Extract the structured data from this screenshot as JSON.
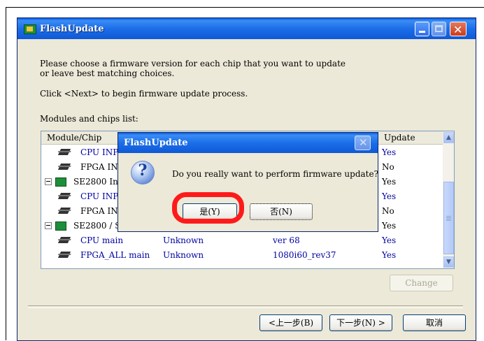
{
  "window": {
    "title": "FlashUpdate",
    "icon": "flash-update-app-icon"
  },
  "instructions": {
    "line1": "Please choose a firmware version for each chip that you want to update",
    "line2": "or leave best matching choices.",
    "line3": "Click <Next> to begin firmware update process.",
    "list_label": "Modules and chips list:"
  },
  "list": {
    "columns": [
      "Module/Chip",
      "Update"
    ],
    "rows": [
      {
        "name": "CPU INP",
        "kind": "chip",
        "status": "",
        "version": "",
        "update": "Yes"
      },
      {
        "name": "FPGA IN",
        "kind": "chip",
        "status": "",
        "version": "",
        "update": "No"
      },
      {
        "name": "SE2800 Inp",
        "kind": "module",
        "status": "",
        "version": "",
        "update": "Yes"
      },
      {
        "name": "CPU INP",
        "kind": "chip",
        "status": "",
        "version": "",
        "update": "Yes"
      },
      {
        "name": "FPGA IN",
        "kind": "chip",
        "status": "",
        "version": "",
        "update": "No"
      },
      {
        "name": "SE2800 / S",
        "kind": "module",
        "status": "",
        "version": "",
        "update": "Yes"
      },
      {
        "name": "CPU main",
        "kind": "chip",
        "status": "Unknown",
        "version": "ver 68",
        "update": "Yes"
      },
      {
        "name": "FPGA_ALL main",
        "kind": "chip",
        "status": "Unknown",
        "version": "1080i60_rev37",
        "update": "Yes"
      }
    ]
  },
  "buttons": {
    "change": "Change",
    "back": "<上一步(B)",
    "next": "下一步(N) >",
    "cancel": "取消"
  },
  "dialog": {
    "title": "FlashUpdate",
    "message": "Do you really want to perform firmware update?",
    "yes": "是(Y)",
    "no": "否(N)",
    "highlight_color": "#ff1a1a"
  }
}
